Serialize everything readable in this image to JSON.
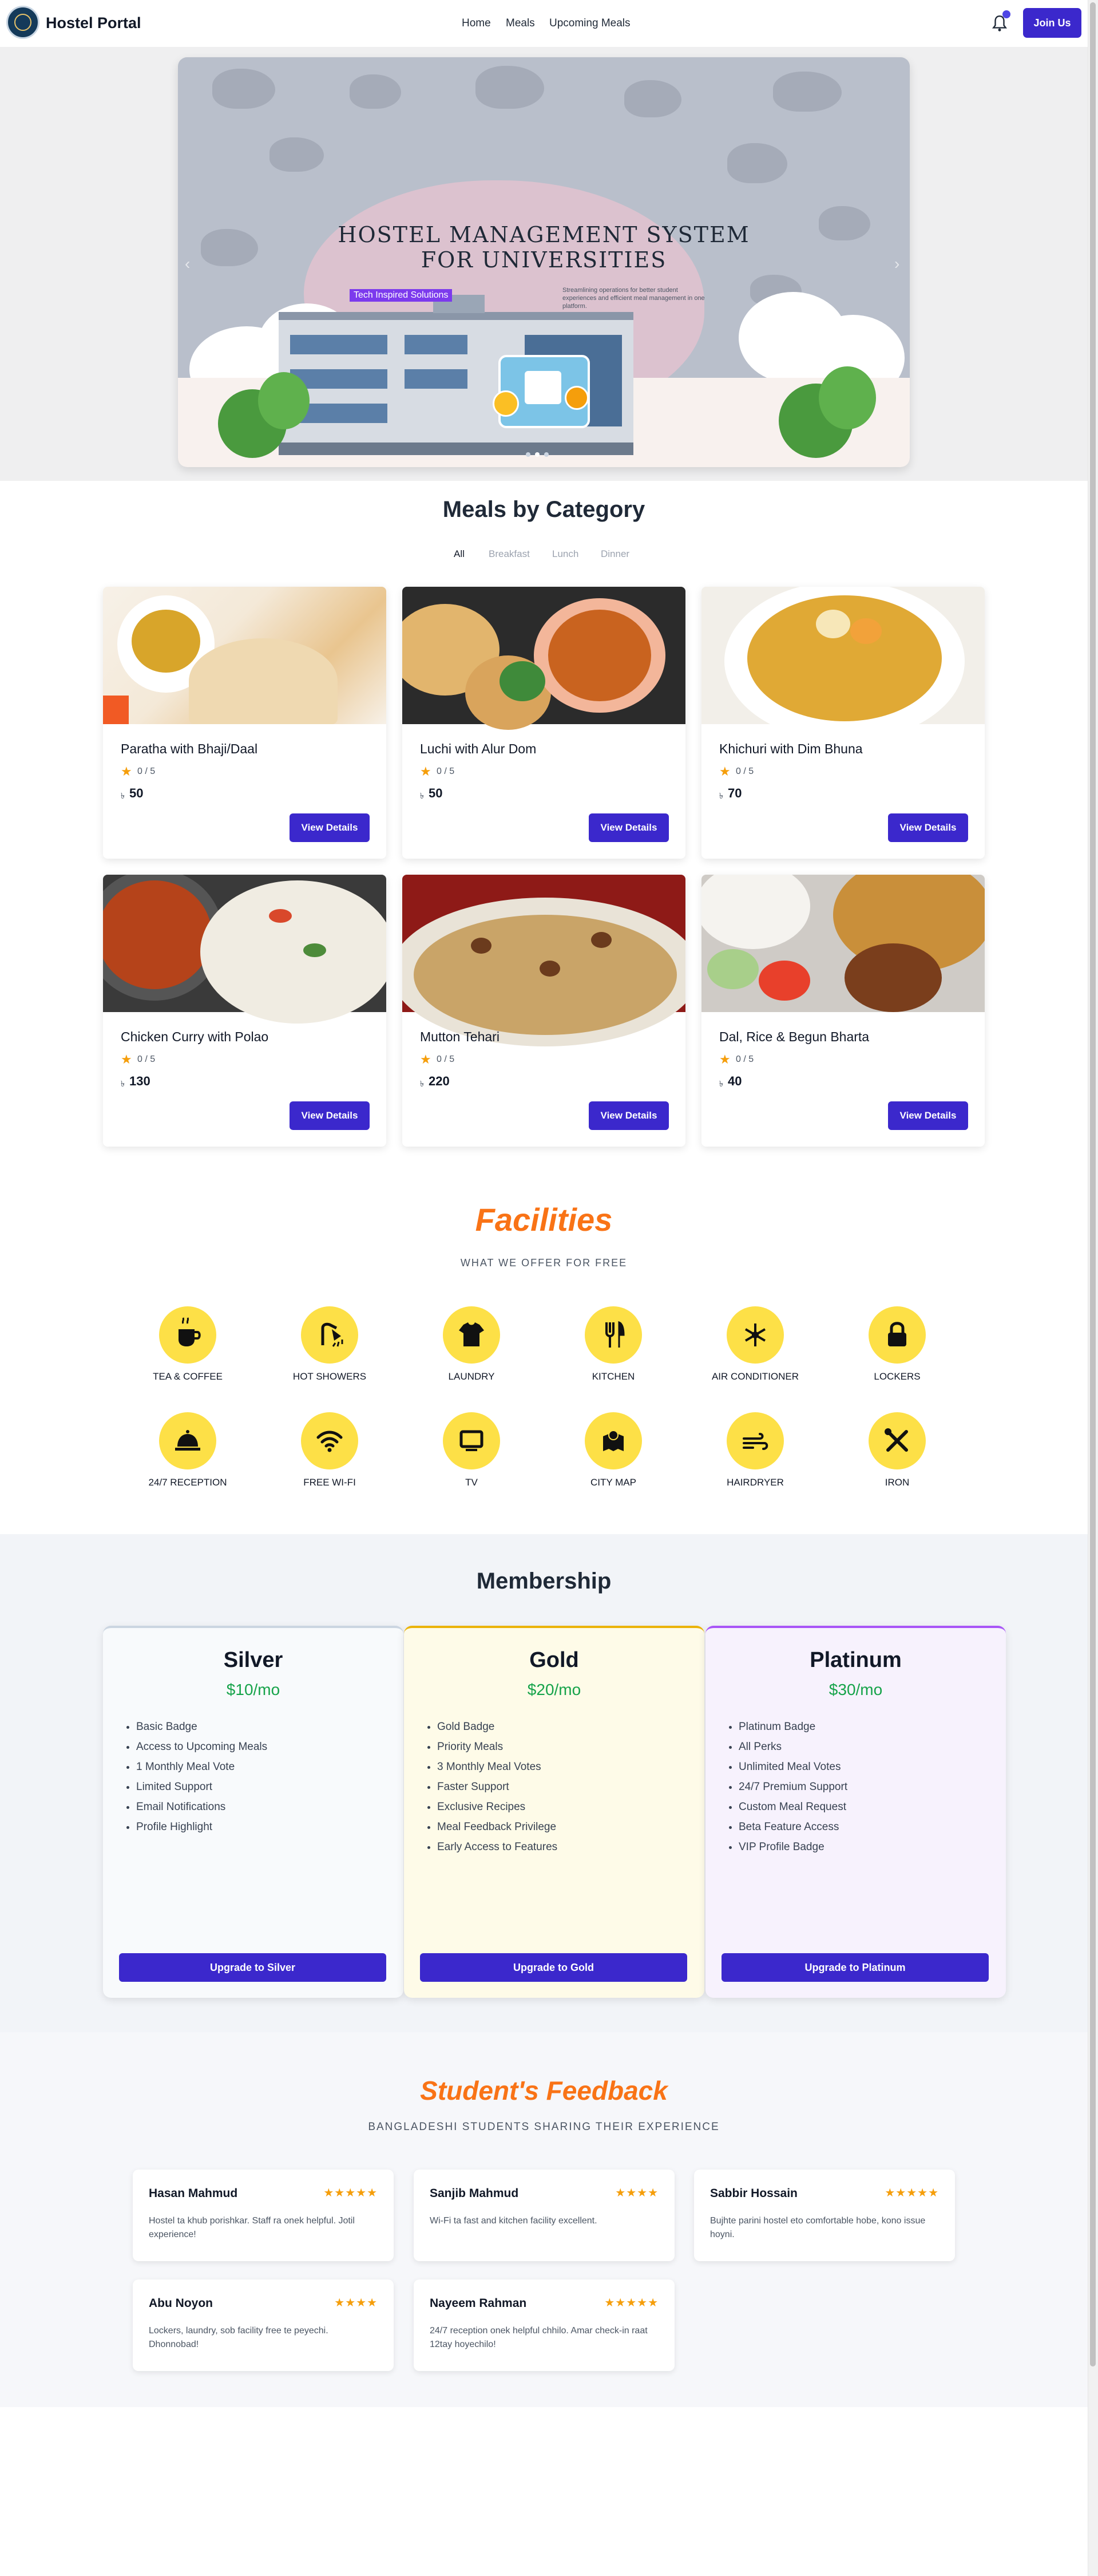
{
  "navbar": {
    "brand": "Hostel Portal",
    "links": [
      "Home",
      "Meals",
      "Upcoming Meals"
    ],
    "join_label": "Join Us",
    "icons": {
      "logo": "university-crest-icon",
      "notifications": "bell-icon"
    }
  },
  "hero": {
    "title_line1": "HOSTEL MANAGEMENT SYSTEM",
    "title_line2": "FOR UNIVERSITIES",
    "tag": "Tech Inspired Solutions",
    "description": "Streamlining operations for better student experiences and efficient meal management in one platform.",
    "prev_arrow": "‹",
    "next_arrow": "›",
    "slides_count": 3,
    "active_slide": 1
  },
  "meals": {
    "title": "Meals by Category",
    "tabs": [
      "All",
      "Breakfast",
      "Lunch",
      "Dinner"
    ],
    "active_tab": "All",
    "currency": "৳",
    "button_label": "View Details",
    "items": [
      {
        "name": "Paratha with Bhaji/Daal",
        "rating": "0 / 5",
        "price": "50"
      },
      {
        "name": "Luchi with Alur Dom",
        "rating": "0 / 5",
        "price": "50"
      },
      {
        "name": "Khichuri with Dim Bhuna",
        "rating": "0 / 5",
        "price": "70"
      },
      {
        "name": "Chicken Curry with Polao",
        "rating": "0 / 5",
        "price": "130"
      },
      {
        "name": "Mutton Tehari",
        "rating": "0 / 5",
        "price": "220"
      },
      {
        "name": "Dal, Rice & Begun Bharta",
        "rating": "0 / 5",
        "price": "40"
      }
    ]
  },
  "facilities": {
    "title": "Facilities",
    "subtitle": "WHAT WE OFFER FOR FREE",
    "accent": "#fde047",
    "items": [
      {
        "label": "TEA & COFFEE",
        "icon": "coffee-cup-icon"
      },
      {
        "label": "HOT SHOWERS",
        "icon": "shower-icon"
      },
      {
        "label": "LAUNDRY",
        "icon": "tshirt-icon"
      },
      {
        "label": "KITCHEN",
        "icon": "utensils-icon"
      },
      {
        "label": "AIR CONDITIONER",
        "icon": "snowflake-icon"
      },
      {
        "label": "LOCKERS",
        "icon": "lock-icon"
      },
      {
        "label": "24/7 RECEPTION",
        "icon": "service-bell-icon"
      },
      {
        "label": "FREE WI-FI",
        "icon": "wifi-icon"
      },
      {
        "label": "TV",
        "icon": "tv-icon"
      },
      {
        "label": "CITY MAP",
        "icon": "map-icon"
      },
      {
        "label": "HAIRDRYER",
        "icon": "wind-icon"
      },
      {
        "label": "IRON",
        "icon": "tools-icon"
      }
    ]
  },
  "membership": {
    "title": "Membership",
    "plans": [
      {
        "name": "Silver",
        "price": "$10/mo",
        "button": "Upgrade to Silver",
        "perks": [
          "Basic Badge",
          "Access to Upcoming Meals",
          "1 Monthly Meal Vote",
          "Limited Support",
          "Email Notifications",
          "Profile Highlight"
        ]
      },
      {
        "name": "Gold",
        "price": "$20/mo",
        "button": "Upgrade to Gold",
        "perks": [
          "Gold Badge",
          "Priority Meals",
          "3 Monthly Meal Votes",
          "Faster Support",
          "Exclusive Recipes",
          "Meal Feedback Privilege",
          "Early Access to Features"
        ]
      },
      {
        "name": "Platinum",
        "price": "$30/mo",
        "button": "Upgrade to Platinum",
        "perks": [
          "Platinum Badge",
          "All Perks",
          "Unlimited Meal Votes",
          "24/7 Premium Support",
          "Custom Meal Request",
          "Beta Feature Access",
          "VIP Profile Badge"
        ]
      }
    ]
  },
  "feedback": {
    "title": "Student's Feedback",
    "subtitle": "BANGLADESHI STUDENTS SHARING THEIR EXPERIENCE",
    "items": [
      {
        "name": "Hasan Mahmud",
        "stars": 5,
        "text": "Hostel ta khub porishkar. Staff ra onek helpful. Jotil experience!"
      },
      {
        "name": "Sanjib Mahmud",
        "stars": 4,
        "text": "Wi-Fi ta fast and kitchen facility excellent."
      },
      {
        "name": "Sabbir Hossain",
        "stars": 5,
        "text": "Bujhte parini hostel eto comfortable hobe, kono issue hoyni."
      },
      {
        "name": "Abu Noyon",
        "stars": 4,
        "text": "Lockers, laundry, sob facility free te peyechi. Dhonnobad!"
      },
      {
        "name": "Nayeem Rahman",
        "stars": 5,
        "text": "24/7 reception onek helpful chhilo. Amar check-in raat 12tay hoyechilo!"
      }
    ]
  }
}
